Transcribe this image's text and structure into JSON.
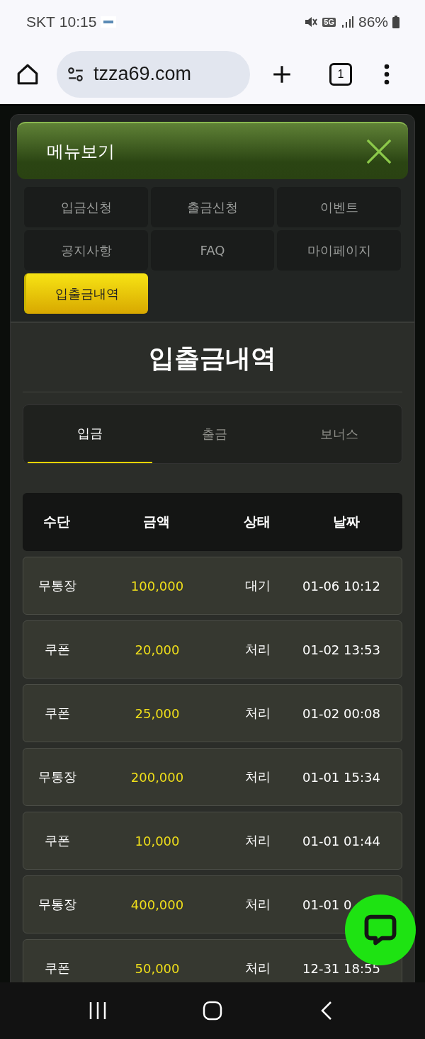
{
  "status_bar": {
    "carrier": "SKT",
    "time": "10:15",
    "network": "5G",
    "battery": "86%"
  },
  "browser": {
    "url": "tzza69.com",
    "tab_count": "1"
  },
  "menu": {
    "title": "메뉴보기",
    "items": [
      {
        "label": "입금신청",
        "selected": false
      },
      {
        "label": "출금신청",
        "selected": false
      },
      {
        "label": "이벤트",
        "selected": false
      },
      {
        "label": "공지사항",
        "selected": false
      },
      {
        "label": "FAQ",
        "selected": false
      },
      {
        "label": "마이페이지",
        "selected": false
      },
      {
        "label": "입출금내역",
        "selected": true
      }
    ]
  },
  "history": {
    "title": "입출금내역",
    "tabs": [
      {
        "label": "입금",
        "selected": true
      },
      {
        "label": "출금",
        "selected": false
      },
      {
        "label": "보너스",
        "selected": false
      }
    ],
    "table": {
      "columns": [
        "수단",
        "금액",
        "상태",
        "날짜"
      ],
      "rows": [
        {
          "method": "무통장",
          "amount": "100,000",
          "status": "대기",
          "date": "01-06 10:12"
        },
        {
          "method": "쿠폰",
          "amount": "20,000",
          "status": "처리",
          "date": "01-02 13:53"
        },
        {
          "method": "쿠폰",
          "amount": "25,000",
          "status": "처리",
          "date": "01-02 00:08"
        },
        {
          "method": "무통장",
          "amount": "200,000",
          "status": "처리",
          "date": "01-01 15:34"
        },
        {
          "method": "쿠폰",
          "amount": "10,000",
          "status": "처리",
          "date": "01-01 01:44"
        },
        {
          "method": "무통장",
          "amount": "400,000",
          "status": "처리",
          "date": "01-01 0"
        },
        {
          "method": "쿠폰",
          "amount": "50,000",
          "status": "처리",
          "date": "12-31 18:55"
        }
      ]
    }
  }
}
